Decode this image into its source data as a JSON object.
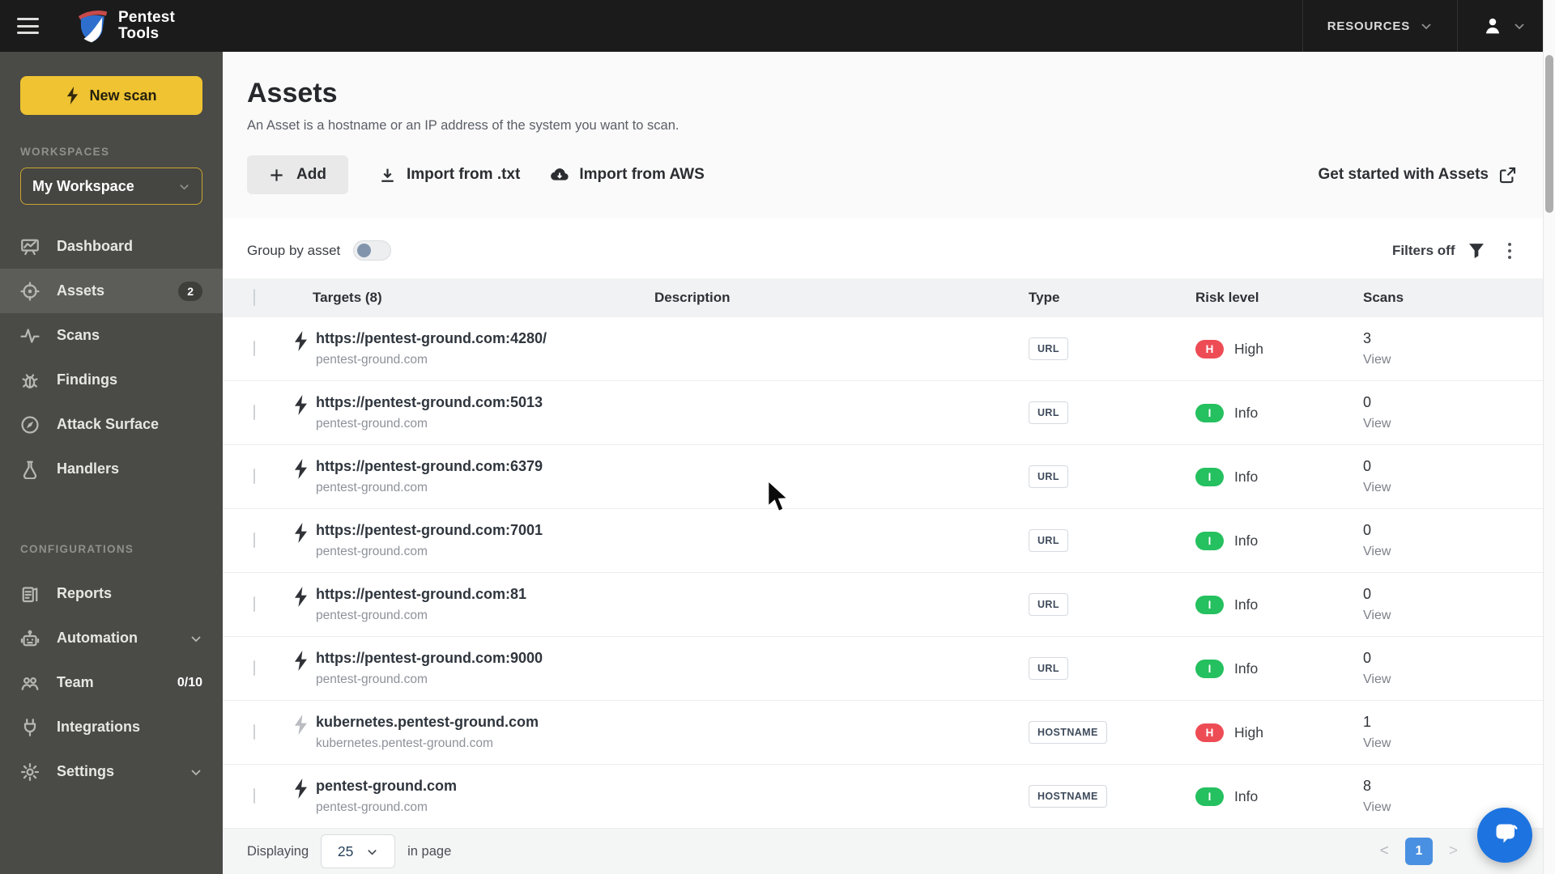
{
  "topbar": {
    "brand_line1": "Pentest",
    "brand_line2": "Tools",
    "resources_label": "RESOURCES"
  },
  "sidebar": {
    "new_scan_label": "New scan",
    "workspaces_label": "WORKSPACES",
    "workspace_selected": "My Workspace",
    "configurations_label": "CONFIGURATIONS",
    "nav": [
      {
        "label": "Dashboard",
        "icon": "dashboard-icon"
      },
      {
        "label": "Assets",
        "icon": "target-icon",
        "badge": "2",
        "active": true
      },
      {
        "label": "Scans",
        "icon": "pulse-icon"
      },
      {
        "label": "Findings",
        "icon": "bug-icon"
      },
      {
        "label": "Attack Surface",
        "icon": "compass-icon"
      },
      {
        "label": "Handlers",
        "icon": "flask-icon"
      }
    ],
    "config_nav": [
      {
        "label": "Reports",
        "icon": "report-icon"
      },
      {
        "label": "Automation",
        "icon": "robot-icon",
        "chevron": true
      },
      {
        "label": "Team",
        "icon": "team-icon",
        "meta": "0/10"
      },
      {
        "label": "Integrations",
        "icon": "plug-icon"
      },
      {
        "label": "Settings",
        "icon": "gear-icon",
        "chevron": true
      }
    ]
  },
  "header": {
    "title": "Assets",
    "subtitle": "An Asset is a hostname or an IP address of the system you want to scan.",
    "add_label": "Add",
    "import_txt_label": "Import from .txt",
    "import_aws_label": "Import from AWS",
    "get_started_label": "Get started with Assets"
  },
  "toolbar": {
    "group_by_label": "Group by asset",
    "filters_label": "Filters off"
  },
  "table": {
    "columns": [
      "Targets (8)",
      "Description",
      "Type",
      "Risk level",
      "Scans"
    ],
    "rows": [
      {
        "target": "https://pentest-ground.com:4280/",
        "subtitle": "pentest-ground.com",
        "description": "",
        "type": "URL",
        "risk_letter": "H",
        "risk": "High",
        "scans": "3",
        "view_label": "View"
      },
      {
        "target": "https://pentest-ground.com:5013",
        "subtitle": "pentest-ground.com",
        "description": "",
        "type": "URL",
        "risk_letter": "I",
        "risk": "Info",
        "scans": "0",
        "view_label": "View"
      },
      {
        "target": "https://pentest-ground.com:6379",
        "subtitle": "pentest-ground.com",
        "description": "",
        "type": "URL",
        "risk_letter": "I",
        "risk": "Info",
        "scans": "0",
        "view_label": "View"
      },
      {
        "target": "https://pentest-ground.com:7001",
        "subtitle": "pentest-ground.com",
        "description": "",
        "type": "URL",
        "risk_letter": "I",
        "risk": "Info",
        "scans": "0",
        "view_label": "View"
      },
      {
        "target": "https://pentest-ground.com:81",
        "subtitle": "pentest-ground.com",
        "description": "",
        "type": "URL",
        "risk_letter": "I",
        "risk": "Info",
        "scans": "0",
        "view_label": "View"
      },
      {
        "target": "https://pentest-ground.com:9000",
        "subtitle": "pentest-ground.com",
        "description": "",
        "type": "URL",
        "risk_letter": "I",
        "risk": "Info",
        "scans": "0",
        "view_label": "View"
      },
      {
        "target": "kubernetes.pentest-ground.com",
        "subtitle": "kubernetes.pentest-ground.com",
        "description": "",
        "type": "HOSTNAME",
        "risk_letter": "H",
        "risk": "High",
        "scans": "1",
        "view_label": "View",
        "dimmed": true
      },
      {
        "target": "pentest-ground.com",
        "subtitle": "pentest-ground.com",
        "description": "",
        "type": "HOSTNAME",
        "risk_letter": "I",
        "risk": "Info",
        "scans": "8",
        "view_label": "View"
      }
    ]
  },
  "footer": {
    "displaying_label": "Displaying",
    "page_size": "25",
    "in_page_label": "in page",
    "prev_label": "<",
    "next_label": ">",
    "page_number": "1"
  },
  "colors": {
    "risk_high": "#ee4c55",
    "risk_info": "#25c05f",
    "accent_yellow": "#efc331",
    "pagination_blue": "#4a90e2",
    "chat_blue": "#1d74e0"
  }
}
